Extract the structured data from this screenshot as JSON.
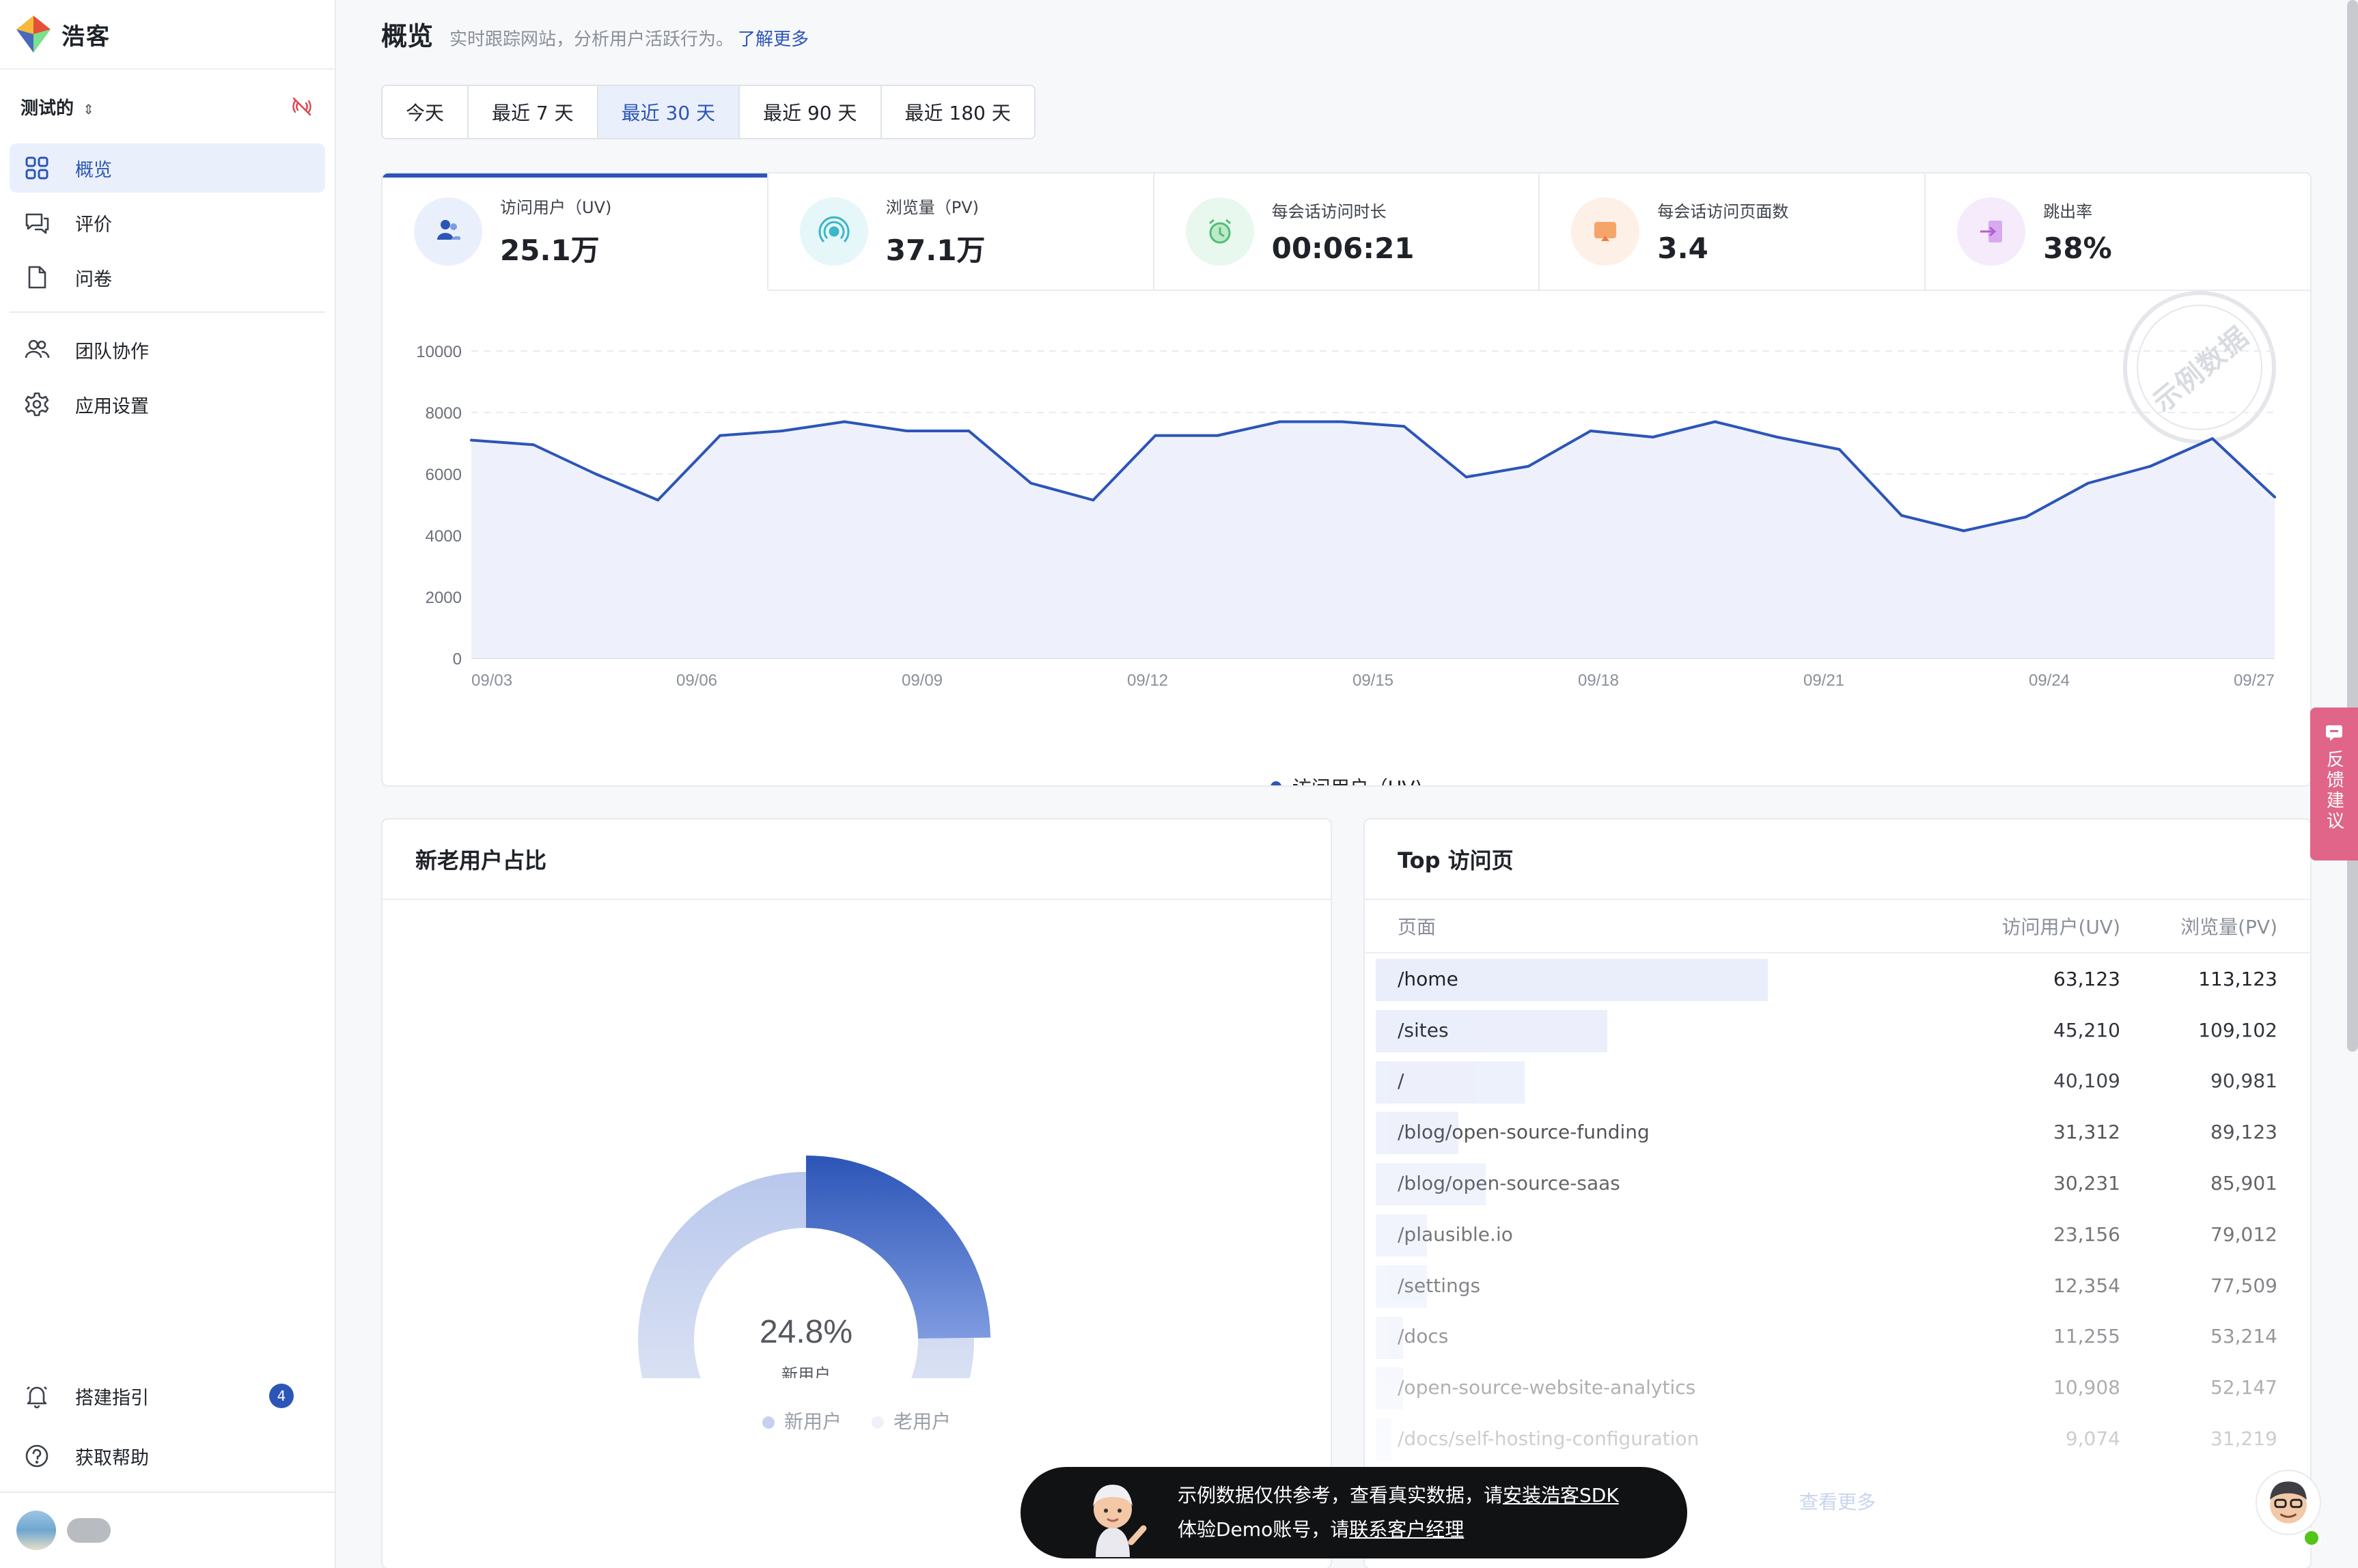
{
  "app": {
    "name": "浩客"
  },
  "project": {
    "name": "测试的"
  },
  "nav": {
    "items": [
      {
        "label": "概览"
      },
      {
        "label": "评价"
      },
      {
        "label": "问卷"
      },
      {
        "label": "团队协作"
      },
      {
        "label": "应用设置"
      }
    ],
    "bottom": [
      {
        "label": "搭建指引",
        "badge": "4"
      },
      {
        "label": "获取帮助"
      }
    ]
  },
  "header": {
    "title": "概览",
    "subtitle": "实时跟踪网站，分析用户活跃行为。",
    "link": "了解更多"
  },
  "range_tabs": [
    "今天",
    "最近 7 天",
    "最近 30 天",
    "最近 90 天",
    "最近 180 天"
  ],
  "active_range": "最近 30 天",
  "metrics": [
    {
      "label": "访问用户（UV)",
      "value": "25.1万",
      "icon": "users-icon",
      "color": "#2c55b8"
    },
    {
      "label": "浏览量（PV)",
      "value": "37.1万",
      "icon": "broadcast-icon",
      "color": "#3cb6c9"
    },
    {
      "label": "每会话访问时长",
      "value": "00:06:21",
      "icon": "clock-icon",
      "color": "#4fbf73"
    },
    {
      "label": "每会话访问页面数",
      "value": "3.4",
      "icon": "pages-icon",
      "color": "#f07c3a"
    },
    {
      "label": "跳出率",
      "value": "38%",
      "icon": "exit-icon",
      "color": "#b15fd6"
    }
  ],
  "stamp_text": "示例数据",
  "chart_data": {
    "type": "area",
    "x": [
      "09/03",
      "09/04",
      "09/05",
      "09/06",
      "09/07",
      "09/08",
      "09/09",
      "09/10",
      "09/11",
      "09/12",
      "09/13",
      "09/14",
      "09/15",
      "09/16",
      "09/17",
      "09/18",
      "09/19",
      "09/20",
      "09/21",
      "09/22",
      "09/23",
      "09/24",
      "09/25",
      "09/26",
      "09/27"
    ],
    "x_ticks": [
      "09/03",
      "09/06",
      "09/09",
      "09/12",
      "09/15",
      "09/18",
      "09/21",
      "09/24",
      "09/27"
    ],
    "series": [
      {
        "name": "访问用户（UV)",
        "color": "#2c55b8",
        "values": [
          7100,
          6950,
          6000,
          5150,
          7250,
          7400,
          7700,
          7400,
          7400,
          5700,
          5150,
          7250,
          7250,
          7700,
          7700,
          7550,
          5900,
          6250,
          7400,
          7200,
          7700,
          7200,
          6800,
          4650,
          4150,
          4600,
          5700,
          6250,
          7150,
          5250
        ]
      }
    ],
    "yticks": [
      0,
      2000,
      4000,
      6000,
      8000,
      10000
    ],
    "ylim": [
      0,
      10000
    ],
    "grid": true,
    "legend": "bottom-center"
  },
  "donut": {
    "title": "新老用户占比",
    "center_value": "24.8%",
    "center_label": "新用户",
    "new_pct": 24.8,
    "legend": [
      {
        "label": "新用户",
        "color": "#c5d1ef"
      },
      {
        "label": "老用户",
        "color": "#eef1f8"
      }
    ]
  },
  "top_pages": {
    "title": "Top 访问页",
    "headers": {
      "page": "页面",
      "uv": "访问用户(UV)",
      "pv": "浏览量(PV)"
    },
    "rows": [
      {
        "page": "/home",
        "uv": "63,123",
        "pv": "113,123",
        "share": 1.0
      },
      {
        "page": "/sites",
        "uv": "45,210",
        "pv": "109,102",
        "share": 0.59
      },
      {
        "page": "/",
        "uv": "40,109",
        "pv": "90,981",
        "share": 0.38
      },
      {
        "page": "/blog/open-source-funding",
        "uv": "31,312",
        "pv": "89,123",
        "share": 0.21
      },
      {
        "page": "/blog/open-source-saas",
        "uv": "30,231",
        "pv": "85,901",
        "share": 0.28
      },
      {
        "page": "/plausible.io",
        "uv": "23,156",
        "pv": "79,012",
        "share": 0.13
      },
      {
        "page": "/settings",
        "uv": "12,354",
        "pv": "77,509",
        "share": 0.13
      },
      {
        "page": "/docs",
        "uv": "11,255",
        "pv": "53,214",
        "share": 0.07
      },
      {
        "page": "/open-source-website-analytics",
        "uv": "10,908",
        "pv": "52,147",
        "share": 0.07
      },
      {
        "page": "/docs/self-hosting-configuration",
        "uv": "9,074",
        "pv": "31,219",
        "share": 0.04
      }
    ],
    "view_more": "查看更多"
  },
  "toast": {
    "line1_prefix": "示例数据仅供参考，查看真实数据，请",
    "line1_link": "安装浩客SDK",
    "line2_prefix": "体验Demo账号，请",
    "line2_link": "联系客户经理"
  },
  "feedback": {
    "label": "反馈建议"
  }
}
